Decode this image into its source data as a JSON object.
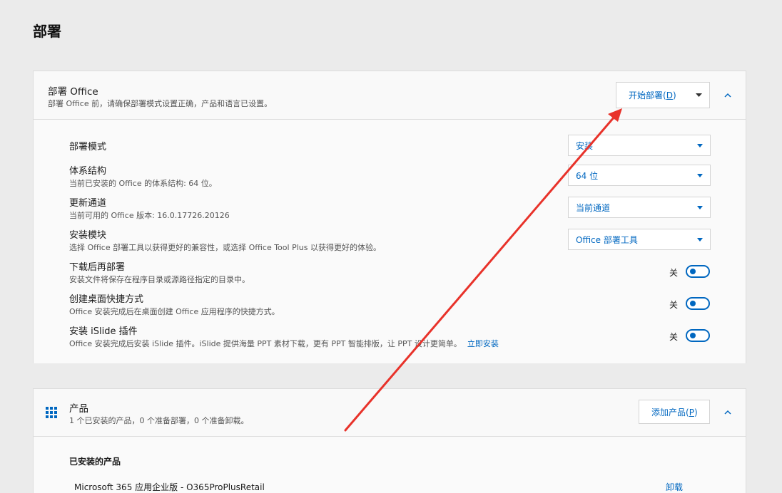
{
  "page": {
    "title": "部署"
  },
  "deploy_card": {
    "title": "部署 Office",
    "description": "部署 Office 前，请确保部署模式设置正确，产品和语言已设置。",
    "start_button": {
      "label": "开始部署(",
      "key": "D",
      "suffix": ")"
    }
  },
  "settings": {
    "mode": {
      "title": "部署模式",
      "value": "安装"
    },
    "arch": {
      "title": "体系结构",
      "desc": "当前已安装的 Office 的体系结构: 64 位。",
      "value": "64 位"
    },
    "channel": {
      "title": "更新通道",
      "desc": "当前可用的 Office 版本: 16.0.17726.20126",
      "value": "当前通道"
    },
    "module": {
      "title": "安装模块",
      "desc": "选择 Office 部署工具以获得更好的兼容性，或选择 Office Tool Plus 以获得更好的体验。",
      "value": "Office 部署工具"
    },
    "download_first": {
      "title": "下载后再部署",
      "desc": "安装文件将保存在程序目录或源路径指定的目录中。",
      "state": "关"
    },
    "shortcut": {
      "title": "创建桌面快捷方式",
      "desc": "Office 安装完成后在桌面创建 Office 应用程序的快捷方式。",
      "state": "关"
    },
    "islide": {
      "title": "安装 iSlide 插件",
      "desc": "Office 安装完成后安装 iSlide 插件。iSlide 提供海量 PPT 素材下载，更有 PPT 智能排版，让 PPT 设计更简单。",
      "link": "立即安装",
      "state": "关"
    }
  },
  "products_card": {
    "title": "产品",
    "description": "1 个已安装的产品，0 个准备部署，0 个准备卸载。",
    "add_button": {
      "label": "添加产品(",
      "key": "P",
      "suffix": ")"
    },
    "installed_title": "已安装的产品",
    "installed": [
      {
        "name": "Microsoft 365 应用企业版  -  O365ProPlusRetail",
        "action": "卸载"
      }
    ]
  },
  "colors": {
    "accent": "#0067c0",
    "annotation_arrow": "#e8322a"
  },
  "icons": [
    "chevron-down-icon",
    "chevron-up-icon",
    "apps-grid-icon",
    "annotation-arrow"
  ]
}
